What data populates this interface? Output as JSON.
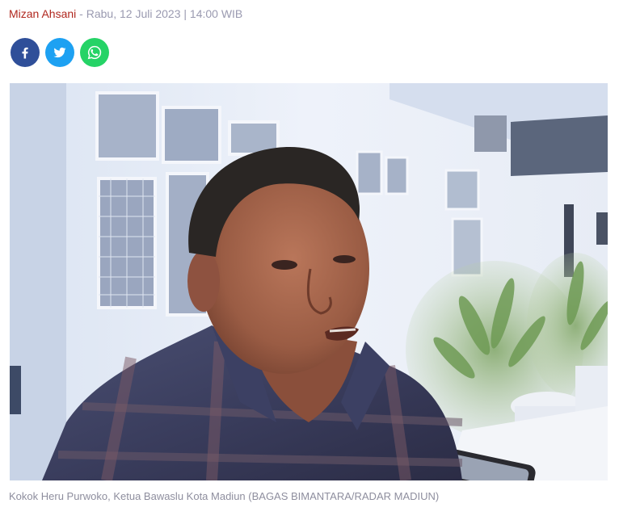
{
  "byline": {
    "author": "Mizan Ahsani",
    "separator": "-",
    "datetime": "Rabu, 12 Juli 2023 | 14:00 WIB"
  },
  "share": {
    "items": [
      {
        "name": "facebook",
        "icon": "facebook-icon",
        "color": "#2f4f99"
      },
      {
        "name": "twitter",
        "icon": "twitter-icon",
        "color": "#1da1f2"
      },
      {
        "name": "whatsapp",
        "icon": "whatsapp-icon",
        "color": "#25d366"
      }
    ]
  },
  "photo": {
    "caption": "Kokok Heru Purwoko, Ketua Bawaslu Kota Madiun (BAGAS BIMANTARA/RADAR MADIUN)"
  }
}
